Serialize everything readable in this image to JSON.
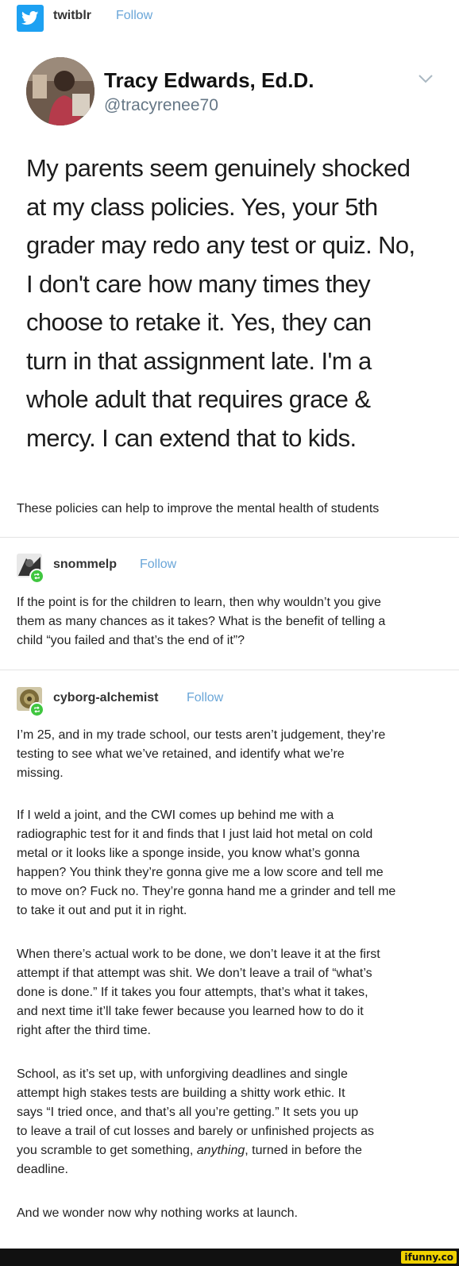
{
  "header": {
    "blog_name": "twitblr",
    "follow_label": "Follow"
  },
  "tweet": {
    "name": "Tracy Edwards, Ed.D.",
    "handle": "@tracyrenee70",
    "lines": [
      "My parents seem genuinely shocked",
      "at my class policies. Yes, your 5th",
      "grader may redo any test or quiz. No,",
      "I don't care how many times they",
      "choose to retake it. Yes, they can",
      "turn in that assignment late. I'm a",
      "whole adult that requires grace &",
      "mercy. I can extend that to kids."
    ]
  },
  "caption": "These policies can help to improve the mental health of students",
  "post1": {
    "user": "snommelp",
    "follow_label": "Follow",
    "lines": [
      "If the point is for the children to learn, then why wouldn’t you give",
      "them as many chances as it takes? What is the benefit of telling a",
      "child “you failed and that’s the end of it”?"
    ]
  },
  "post2": {
    "user": "cyborg-alchemist",
    "follow_label": "Follow",
    "paragraphs": [
      [
        "I’m 25, and in my trade school, our tests aren’t judgement, they’re",
        "testing to see what we’ve retained, and identify what we’re",
        "missing."
      ],
      [
        "If I weld a joint, and the CWI comes up behind me with a",
        "radiographic test for it and finds that I just laid hot metal on cold",
        "metal or it looks like a sponge inside, you know what’s gonna",
        "happen? You think they’re gonna give me a low score and tell me",
        "to move on? Fuck no. They’re gonna hand me a grinder and tell me",
        "to take it out and put it in right."
      ],
      [
        "When there’s actual work to be done, we don’t leave it at the first",
        "attempt if that attempt was shit. We don’t leave a trail of “what’s",
        "done is done.” If it takes you four attempts, that’s what it takes,",
        "and next time it’ll take fewer because you learned how to do it",
        "right after the third time."
      ],
      [
        "School, as it’s set up, with unforgiving deadlines and single",
        "attempt high stakes tests are building a shitty work ethic. It",
        "says “I tried once, and that’s all you’re getting.” It sets you up",
        "to leave a trail of cut losses and barely or unfinished projects as"
      ],
      [
        "And we wonder now why nothing works at launch."
      ]
    ],
    "p4_line5_before": "you scramble to get something, ",
    "p4_line5_em": "anything",
    "p4_line5_after": ", turned in before the",
    "p4_line6": "deadline."
  },
  "watermark": "ifunny.co",
  "icons": {
    "app": "twitter-bird-icon",
    "reblog": "reblog-icon",
    "chevron": "chevron-down-icon"
  },
  "colors": {
    "twitter_blue": "#1da1f2",
    "follow": "#6aa6d8",
    "reblog_green": "#3fc63f"
  }
}
